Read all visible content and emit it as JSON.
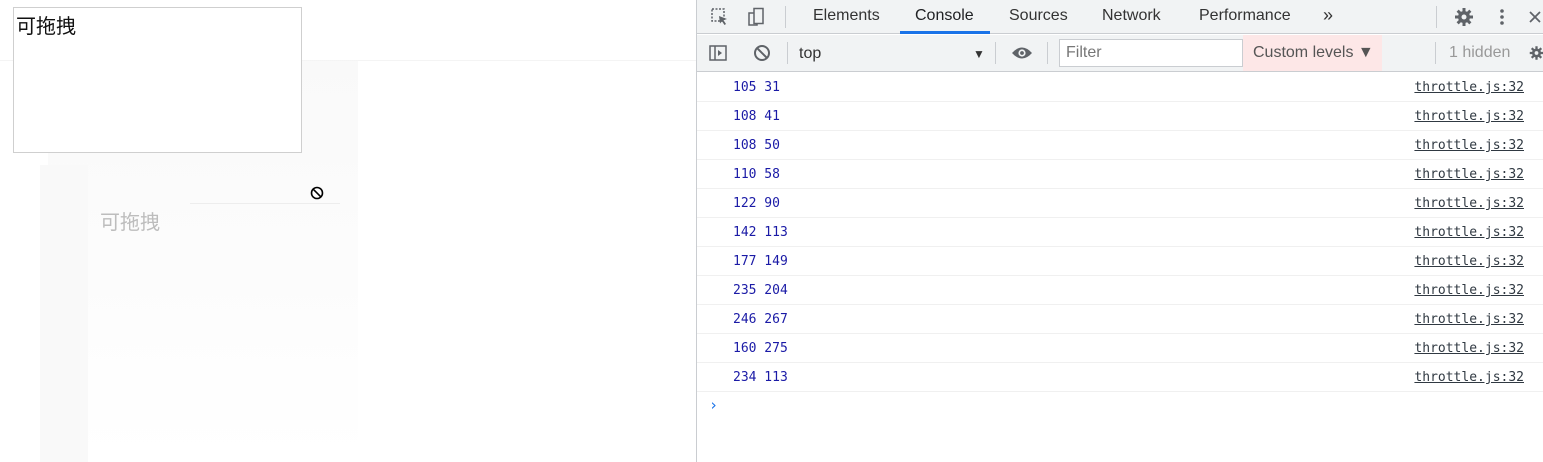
{
  "page": {
    "drag_box_text": "可拖拽",
    "ghost_text": "可拖拽",
    "cursor_icon": "no-drop-cursor-icon"
  },
  "devtools": {
    "tabs": [
      {
        "label": "Elements",
        "active": false
      },
      {
        "label": "Console",
        "active": true
      },
      {
        "label": "Sources",
        "active": false
      },
      {
        "label": "Network",
        "active": false
      },
      {
        "label": "Performance",
        "active": false
      }
    ],
    "more_tabs": "»",
    "icons": {
      "inspect": "inspect-element-icon",
      "device": "device-toolbar-icon",
      "settings": "settings-gear-icon",
      "menu": "kebab-menu-icon",
      "close": "close-icon",
      "sidebar": "show-sidebar-icon",
      "clear": "clear-console-icon",
      "eye": "live-expression-eye-icon",
      "console_settings": "console-settings-gear-icon"
    },
    "toolbar": {
      "context": "top",
      "filter_placeholder": "Filter",
      "levels": "Custom levels ▼",
      "hidden": "1 hidden"
    },
    "console": {
      "messages": [
        {
          "text": "105 31",
          "source": "throttle.js:32"
        },
        {
          "text": "108 41",
          "source": "throttle.js:32"
        },
        {
          "text": "108 50",
          "source": "throttle.js:32"
        },
        {
          "text": "110 58",
          "source": "throttle.js:32"
        },
        {
          "text": "122 90",
          "source": "throttle.js:32"
        },
        {
          "text": "142 113",
          "source": "throttle.js:32"
        },
        {
          "text": "177 149",
          "source": "throttle.js:32"
        },
        {
          "text": "235 204",
          "source": "throttle.js:32"
        },
        {
          "text": "246 267",
          "source": "throttle.js:32"
        },
        {
          "text": "160 275",
          "source": "throttle.js:32"
        },
        {
          "text": "234 113",
          "source": "throttle.js:32"
        }
      ],
      "prompt": "›"
    },
    "colors": {
      "message": "#1a1aa6",
      "accent": "#1a73e8",
      "levels_bg": "#fde7e7"
    }
  }
}
